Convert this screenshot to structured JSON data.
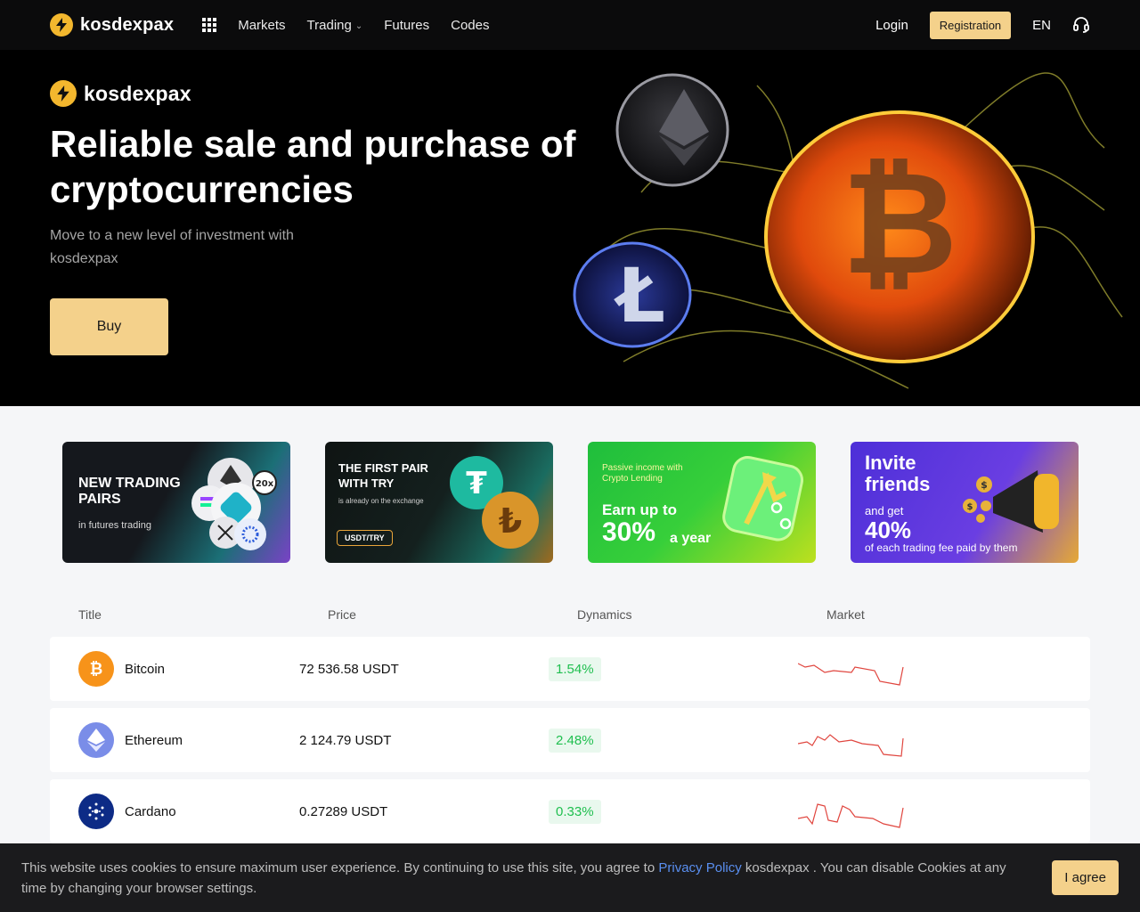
{
  "nav": {
    "logo": "kosdexpax",
    "menu": [
      {
        "label": "Markets"
      },
      {
        "label": "Trading"
      },
      {
        "label": "Futures"
      },
      {
        "label": "Codes"
      }
    ],
    "login": "Login",
    "registration": "Registration",
    "lang": "EN"
  },
  "hero": {
    "logo": "kosdexpax",
    "title": "Reliable sale and purchase of cryptocurrencies",
    "subtitle": "Move to a new level of investment with kosdexpax",
    "buy": "Buy"
  },
  "promos": {
    "p1": {
      "title": "NEW TRADING PAIRS",
      "sub": "in futures trading",
      "badge": "20x"
    },
    "p2": {
      "title": "THE FIRST PAIR WITH TRY",
      "sub": "is already on the exchange",
      "tag": "USDT/TRY"
    },
    "p3": {
      "top": "Passive income with Crypto Lending",
      "earn": "Earn up to",
      "pct": "30%",
      "suffix": "a year"
    },
    "p4": {
      "title": "Invite friends",
      "and_get": "and get",
      "pct": "40%",
      "sub": "of each trading fee paid by them"
    }
  },
  "table": {
    "headers": [
      "Title",
      "Price",
      "Dynamics",
      "Market"
    ],
    "rows": [
      {
        "name": "Bitcoin",
        "price": "72 536.58 USDT",
        "dyn": "1.54%"
      },
      {
        "name": "Ethereum",
        "price": "2 124.79 USDT",
        "dyn": "2.48%"
      },
      {
        "name": "Cardano",
        "price": "0.27289 USDT",
        "dyn": "0.33%"
      }
    ]
  },
  "cookie": {
    "text1": "This website uses cookies to ensure maximum user experience. By continuing to use this site, you agree to",
    "link": "Privacy Policy",
    "text2": "kosdexpax . You can disable Cookies at any time by changing your browser settings.",
    "agree": "I agree"
  },
  "colors": {
    "accent": "#f4d18b",
    "brand": "#f3b72e",
    "positive": "#1fbf4f",
    "negative": "#e0453e",
    "link": "#5a8ff0"
  }
}
